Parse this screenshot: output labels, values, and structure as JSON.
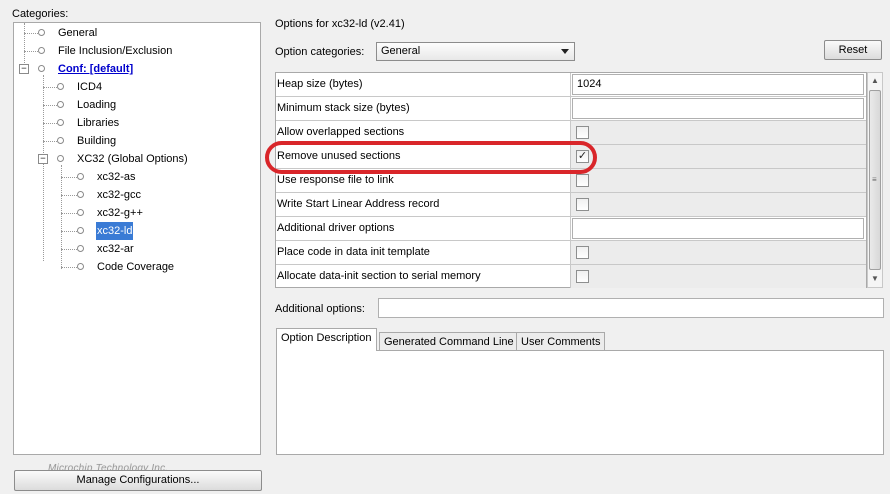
{
  "categories": {
    "label": "Categories:",
    "items": [
      {
        "label": "General"
      },
      {
        "label": "File Inclusion/Exclusion"
      },
      {
        "label": "Conf: [default]"
      },
      {
        "label": "ICD4"
      },
      {
        "label": "Loading"
      },
      {
        "label": "Libraries"
      },
      {
        "label": "Building"
      },
      {
        "label": "XC32 (Global Options)"
      },
      {
        "label": "xc32-as"
      },
      {
        "label": "xc32-gcc"
      },
      {
        "label": "xc32-g++"
      },
      {
        "label": "xc32-ld"
      },
      {
        "label": "xc32-ar"
      },
      {
        "label": "Code Coverage"
      }
    ]
  },
  "watermark": "Microchip Technology Inc.",
  "manage_button": "Manage Configurations...",
  "options": {
    "title": "Options for xc32-ld (v2.41)",
    "category_label": "Option categories:",
    "category_selected": "General",
    "reset_label": "Reset",
    "rows": [
      {
        "label": "Heap size (bytes)",
        "value": "1024"
      },
      {
        "label": "Minimum stack size (bytes)",
        "value": ""
      },
      {
        "label": "Allow overlapped sections",
        "checked": false
      },
      {
        "label": "Remove unused sections",
        "checked": true
      },
      {
        "label": "Use response file to link",
        "checked": false
      },
      {
        "label": "Write Start Linear Address record",
        "checked": false
      },
      {
        "label": "Additional driver options",
        "value": ""
      },
      {
        "label": "Place code in data init template",
        "checked": false
      },
      {
        "label": "Allocate data-init section to serial memory",
        "checked": false
      }
    ],
    "additional_options_label": "Additional options:",
    "additional_options_value": ""
  },
  "tabs": [
    {
      "label": "Option Description"
    },
    {
      "label": "Generated Command Line"
    },
    {
      "label": "User Comments"
    }
  ],
  "icons": {
    "checkmark": "✓",
    "grip": "≡"
  },
  "colors": {
    "highlight": "#d9262a",
    "link": "#0000cc",
    "selection": "#3a7bd5"
  }
}
